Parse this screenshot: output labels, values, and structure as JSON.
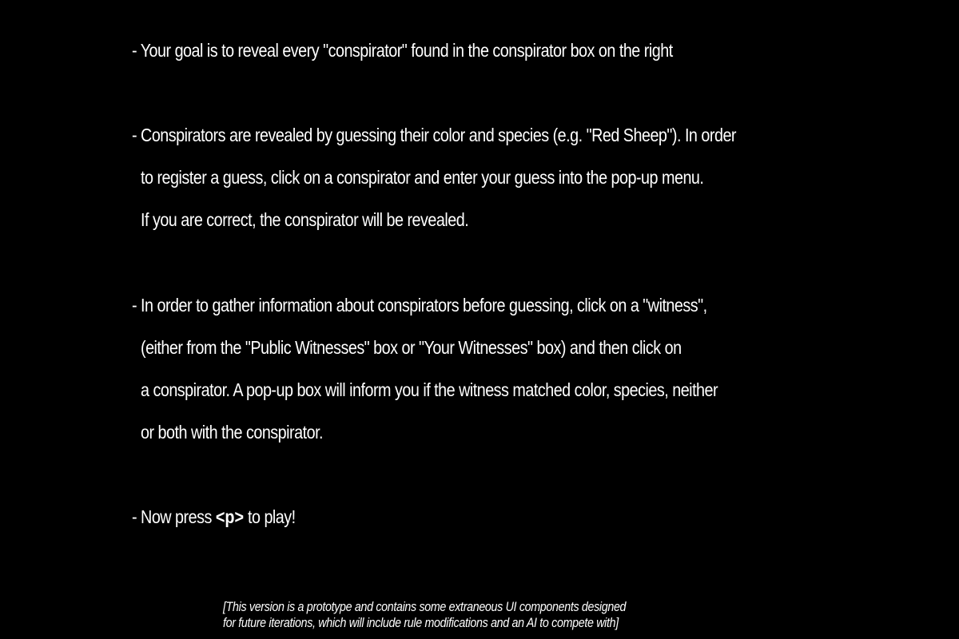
{
  "instructions": {
    "goal": "- Your goal is to reveal every \"conspirator\" found in the conspirator box on the right",
    "reveal_line1": "- Conspirators are revealed by guessing their color and species (e.g. \"Red Sheep\"). In order",
    "reveal_line2": "to register a guess, click on a conspirator and enter your guess into the pop-up menu.",
    "reveal_line3": "If you are correct, the conspirator will be revealed.",
    "gather_line1": "- In order to gather information about conspirators before guessing, click on a \"witness\",",
    "gather_line2": "(either from the \"Public Witnesses\" box or \"Your Witnesses\" box) and then click on",
    "gather_line3": "a conspirator. A pop-up box will inform you if the witness matched color, species, neither",
    "gather_line4": "or both with the conspirator.",
    "play_prefix": "- Now press ",
    "play_key": "<p>",
    "play_suffix": " to play!"
  },
  "footnote": {
    "line1": "[This version is a prototype and contains some extraneous UI components designed",
    "line2": "for future iterations, which will include rule modifications and an AI to compete with]"
  }
}
